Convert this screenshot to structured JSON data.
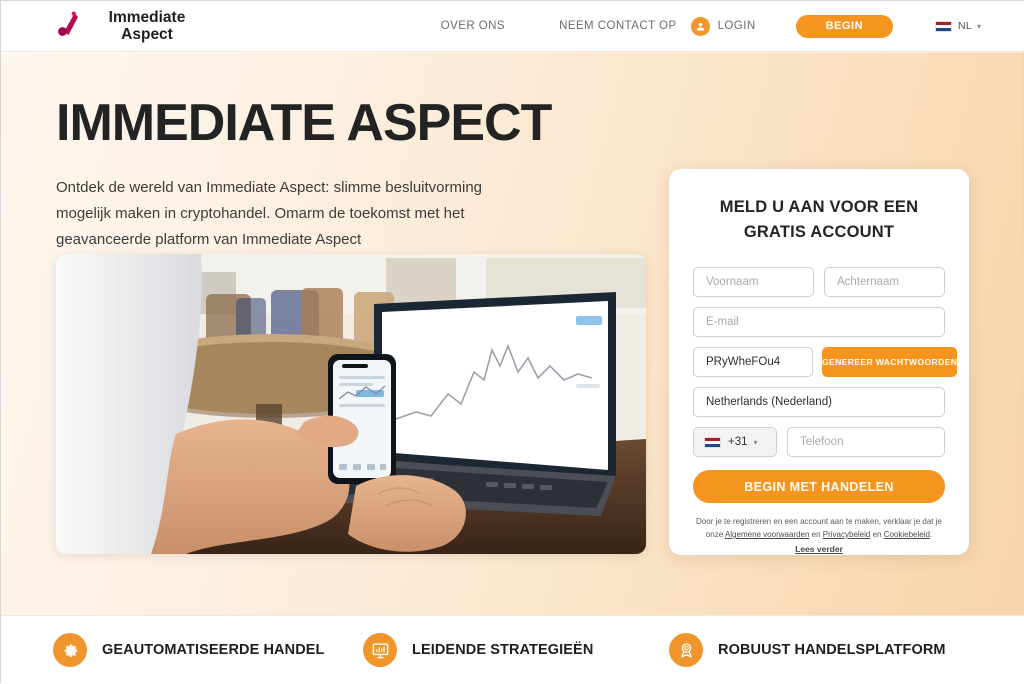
{
  "header": {
    "brand_line1": "Immediate",
    "brand_line2": "Aspect",
    "logo_icon": "immediate-aspect-logo",
    "nav": [
      {
        "label": "OVER ONS",
        "name": "nav-over-ons"
      },
      {
        "label": "NEEM CONTACT OP",
        "name": "nav-neem-contact-op"
      }
    ],
    "login_label": "LOGIN",
    "login_icon": "user-badge-icon",
    "begin_label": "BEGIN",
    "language": {
      "label": "NL",
      "flag_icon": "netherlands-flag-icon",
      "caret_icon": "chevron-down-icon"
    }
  },
  "hero": {
    "title": "IMMEDIATE ASPECT",
    "subtitle": "Ontdek de wereld van Immediate Aspect: slimme besluitvorming mogelijk maken in cryptohandel. Omarm de toekomst met het geavanceerde platform van Immediate Aspect",
    "photo_alt": "Persoon met smartphone en laptop met handelsgrafiek"
  },
  "signup": {
    "title": "MELD U AAN VOOR EEN GRATIS ACCOUNT",
    "first_name_placeholder": "Voornaam",
    "last_name_placeholder": "Achternaam",
    "email_placeholder": "E-mail",
    "password_value": "PRyWheFOu4",
    "generate_password_label": "GENEREER WACHTWOORDEN",
    "country_value": "Netherlands (Nederland)",
    "dial_code": "+31",
    "dial_flag_icon": "netherlands-flag-icon",
    "dial_caret_icon": "chevron-down-icon",
    "phone_placeholder": "Telefoon",
    "submit_label": "BEGIN MET HANDELEN",
    "legal_line1": "Door je te registreren en een account aan te maken, verklaar je dat je",
    "legal_prefix": "onze ",
    "legal_link_terms": "Algemene voorwaarden",
    "legal_sep1": " en ",
    "legal_link_privacy": "Privacybeleid",
    "legal_sep2": " en ",
    "legal_link_cookies": "Cookiebeleid",
    "legal_suffix": ".",
    "read_more_label": "Lees verder"
  },
  "features": [
    {
      "label": "GEAUTOMATISEERDE HANDEL",
      "icon": "gear-icon",
      "name": "feature-geautomatiseerde-handel"
    },
    {
      "label": "LEIDENDE STRATEGIEËN",
      "icon": "monitor-chart-icon",
      "name": "feature-leidende-strategieen"
    },
    {
      "label": "ROBUUST HANDELSPLATFORM",
      "icon": "award-medal-icon",
      "name": "feature-robuust-handelsplatform"
    }
  ],
  "colors": {
    "accent_orange": "#f5941f",
    "logo_crimson": "#c2185b",
    "background_peach": "#fbe4c8",
    "text_dark": "#232323"
  }
}
